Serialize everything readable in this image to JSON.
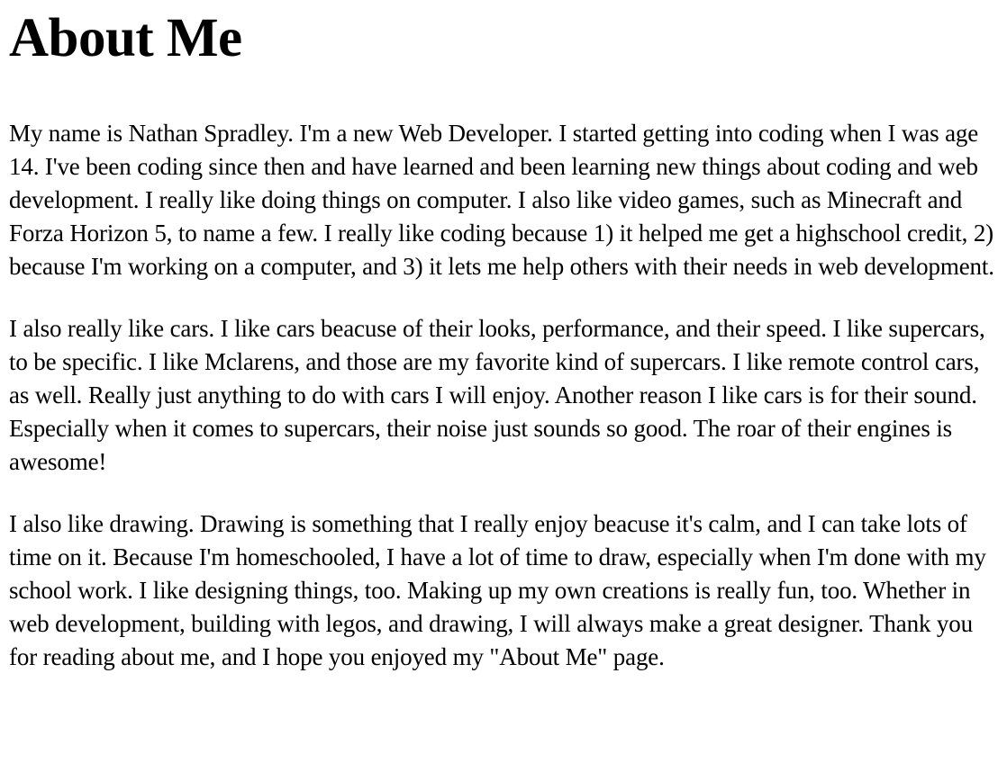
{
  "page": {
    "title": "About Me",
    "paragraphs": [
      "My name is Nathan Spradley. I'm a new Web Developer. I started getting into coding when I was age 14. I've been coding since then and have learned and been learning new things about coding and web development. I really like doing things on computer. I also like video games, such as Minecraft and Forza Horizon 5, to name a few. I really like coding because 1) it helped me get a highschool credit, 2) because I'm working on a computer, and 3) it lets me help others with their needs in web development.",
      "I also really like cars. I like cars beacuse of their looks, performance, and their speed. I like supercars, to be specific. I like Mclarens, and those are my favorite kind of supercars. I like remote control cars, as well. Really just anything to do with cars I will enjoy. Another reason I like cars is for their sound. Especially when it comes to supercars, their noise just sounds so good. The roar of their engines is awesome!",
      "I also like drawing. Drawing is something that I really enjoy beacuse it's calm, and I can take lots of time on it. Because I'm homeschooled, I have a lot of time to draw, especially when I'm done with my school work. I like designing things, too. Making up my own creations is really fun, too. Whether in web development, building with legos, and drawing, I will always make a great designer. Thank you for reading about me, and I hope you enjoyed my \"About Me\" page."
    ]
  }
}
